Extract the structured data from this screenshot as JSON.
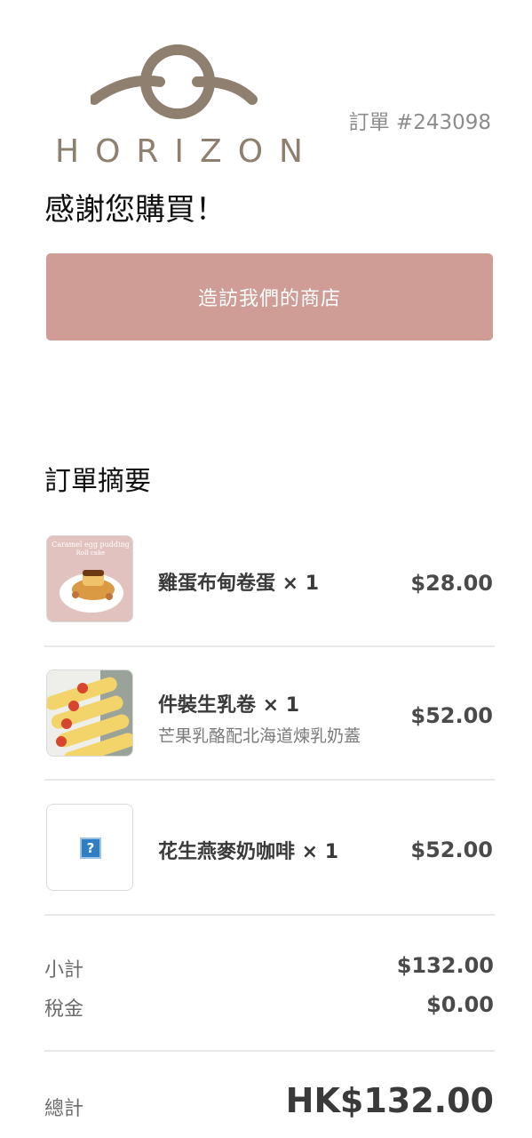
{
  "header": {
    "logo_text": "HORIZON",
    "order_number": "訂單 #243098"
  },
  "thanks_message": "感謝您購買！",
  "visit_button_label": "造訪我們的商店",
  "summary": {
    "title": "訂單摘要",
    "items": [
      {
        "name": "雞蛋布甸卷蛋 × 1",
        "description": "",
        "price": "$28.00",
        "image_label_1": "Caramel egg pudding",
        "image_label_2": "Roll cake"
      },
      {
        "name": "件裝生乳卷 × 1",
        "description": "芒果乳酪配北海道煉乳奶蓋",
        "price": "$52.00"
      },
      {
        "name": "花生燕麥奶咖啡 × 1",
        "description": "",
        "price": "$52.00",
        "placeholder_glyph": "?"
      }
    ]
  },
  "totals": {
    "subtotal_label": "小計",
    "subtotal_value": "$132.00",
    "tax_label": "稅金",
    "tax_value": "$0.00",
    "total_label": "總計",
    "total_value": "HK$132.00"
  },
  "colors": {
    "button": "#cf9d96",
    "logo": "#8f7f6f",
    "divider": "#e8e8e8"
  }
}
